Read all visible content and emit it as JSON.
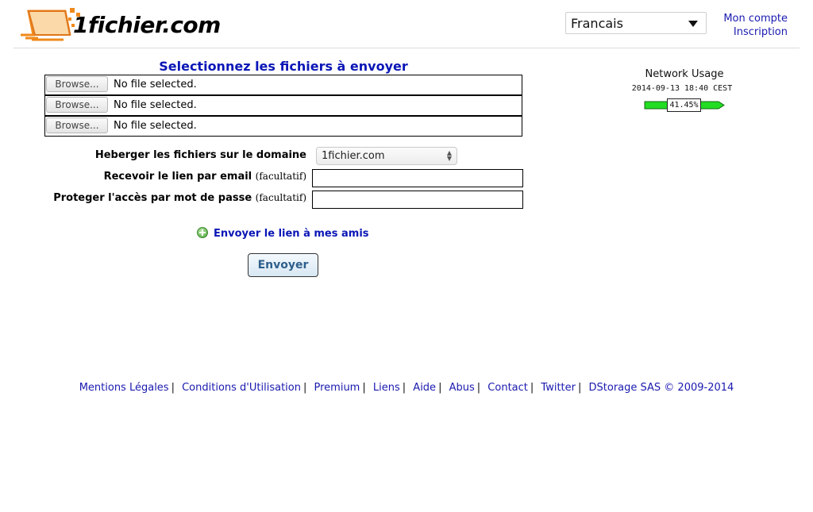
{
  "header": {
    "logo_text": "1fichier.com",
    "language": "Francais",
    "links": [
      "Mon compte",
      "Inscription"
    ]
  },
  "upload": {
    "title": "Selectionnez les fichiers à envoyer",
    "browse_label": "Browse...",
    "rows": [
      {
        "status": "No file selected."
      },
      {
        "status": "No file selected."
      },
      {
        "status": "No file selected."
      }
    ]
  },
  "form": {
    "domain_label": "Heberger les fichiers sur le domaine",
    "domain_value": "1fichier.com",
    "email_label": "Recevoir le lien par email",
    "password_label": "Proteger l'accès par mot de passe",
    "optional": "(facultatif)",
    "friends_link": "Envoyer le lien à mes amis",
    "send_button": "Envoyer"
  },
  "network": {
    "title": "Network Usage",
    "timestamp": "2014-09-13 18:40 CEST",
    "usage_label": "41.45%",
    "usage_value": 41.45,
    "bar_color": "#22dd22"
  },
  "footer": {
    "links": [
      "Mentions Légales",
      "Conditions d'Utilisation",
      "Premium",
      "Liens",
      "Aide",
      "Abus",
      "Contact",
      "Twitter"
    ],
    "copyright": "DStorage SAS © 2009-2014"
  },
  "colors": {
    "title_blue": "#0a16b6",
    "link_blue": "#1a1ab0",
    "logo_orange": "#f08a1c"
  }
}
